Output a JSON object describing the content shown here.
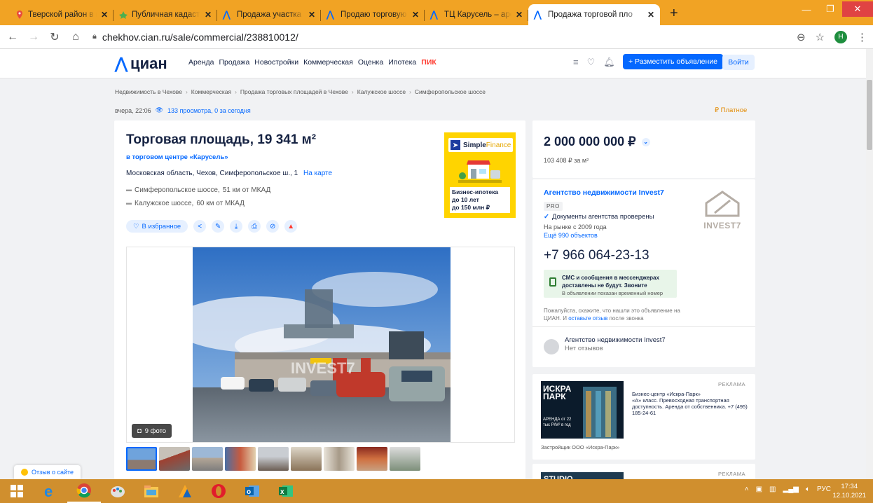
{
  "browser": {
    "tabs": [
      {
        "title": "Тверской район в горо",
        "favicon": "map-pin-icon",
        "active": false
      },
      {
        "title": "Публичная кадастрова",
        "favicon": "map-icon",
        "active": false
      },
      {
        "title": "Продажа участка 17сот",
        "favicon": "cian-icon",
        "active": false
      },
      {
        "title": "Продаю торговую пло",
        "favicon": "cian-icon",
        "active": false
      },
      {
        "title": "ТЦ Карусель – аренда",
        "favicon": "cian-icon",
        "active": false
      },
      {
        "title": "Продажа торговой пло",
        "favicon": "cian-icon",
        "active": true
      }
    ],
    "new_tab": "+",
    "close_tab": "✕",
    "url": "chekhov.cian.ru/sale/commercial/238810012/",
    "profile_initial": "Н"
  },
  "site": {
    "logo_text": "циан",
    "nav": [
      "Аренда",
      "Продажа",
      "Новостройки",
      "Коммерческая",
      "Оценка",
      "Ипотека"
    ],
    "nav_pik": "ПИК",
    "post_button": "+ Разместить объявление",
    "login_button": "Войти"
  },
  "breadcrumbs": [
    "Недвижимость в Чехове",
    "Коммерческая",
    "Продажа торговых площадей в Чехове",
    "Калужское шоссе",
    "Симферопольское шоссе"
  ],
  "meta": {
    "date": "вчера, 22:06",
    "views": "133 просмотра, 0 за сегодня",
    "paid": "₽ Платное"
  },
  "listing": {
    "title": "Торговая площадь, 19 341 м²",
    "mall": "в торговом центре «Карусель»",
    "address": "Московская область, Чехов, Симферопольское ш., 1",
    "map_link": "На карте",
    "highways": [
      {
        "name": "Симферопольское шоссе,",
        "distance": "51 км от МКАД"
      },
      {
        "name": "Калужское шоссе,",
        "distance": "60 км от МКАД"
      }
    ],
    "favorite_button": "В избранное",
    "photo_count": "9 фото"
  },
  "ad_simplefinance": {
    "brand_a": "Simple",
    "brand_b": "Finance",
    "line1": "Бизнес-ипотека",
    "line2": "до 10 лет",
    "line3": "до 150 млн ₽"
  },
  "price": {
    "value": "2 000 000 000 ₽",
    "per_m2": "103 408 ₽ за м²"
  },
  "agent": {
    "name": "Агентство недвижимости Invest7",
    "badge": "PRO",
    "verified": "Документы агентства проверены",
    "since": "На рынке с 2009 года",
    "more": "Ещё 990 объектов",
    "logo_text": "INVEST7",
    "phone": "+7 966 064-23-13",
    "sms_line1": "СМС и сообщения в мессенджерах доставлены не будут. Звоните",
    "sms_line2": "В объявлении показан временный номер",
    "ask_text": "Пожалуйста, скажите, что нашли это объявление на ЦИАН. И",
    "ask_link": "оставьте отзыв",
    "ask_after": "после звонка",
    "review_name": "Агентство недвижимости Invest7",
    "review_none": "Нет отзывов"
  },
  "ad_iskra": {
    "label": "РЕКЛАМА",
    "name_line1": "ИСКРА",
    "name_line2": "ПАРК",
    "price_text": "АРЕНДА от 22 тыс Р/М² в год",
    "title": "Бизнес-центр «Искра-Парк»",
    "text": "«А» класс. Превосходная транспортная доступность. Аренда от собственника. +7 (495) 185-24-61",
    "developer": "Застройщик ООО «Искра-Парк»"
  },
  "ad_studio": {
    "label": "РЕКЛАМА",
    "name": "STUDIO"
  },
  "feedback": "Отзыв о сайте",
  "taskbar": {
    "lang": "РУС",
    "time": "17:34",
    "date": "12.10.2021"
  },
  "colors": {
    "accent": "#0468ff",
    "chrome_frame": "#f1a324",
    "taskbar": "#d08f2e",
    "paid": "#e38a00",
    "ad_yellow": "#ffd400"
  }
}
